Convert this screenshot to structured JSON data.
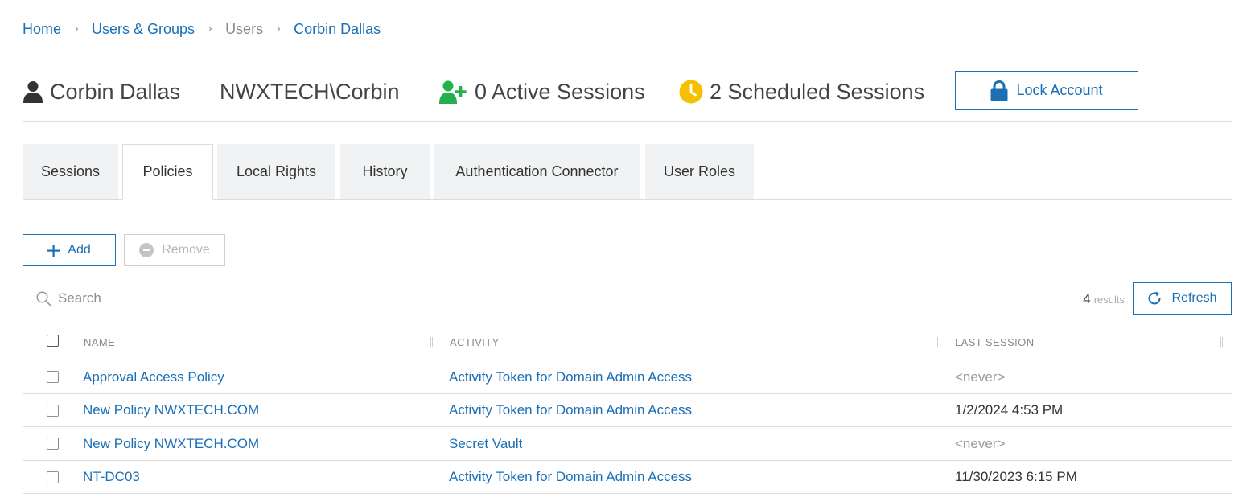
{
  "breadcrumb": {
    "home": "Home",
    "users_groups": "Users & Groups",
    "users": "Users",
    "current": "Corbin Dallas",
    "separator": "›"
  },
  "header": {
    "user_name": "Corbin Dallas",
    "account": "NWXTECH\\Corbin",
    "active_sessions": "0 Active Sessions",
    "scheduled_sessions": "2 Scheduled Sessions",
    "lock_button": "Lock Account",
    "icons": {
      "user": "user-icon",
      "active": "user-plus-icon",
      "scheduled": "clock-icon",
      "lock": "lock-icon"
    },
    "colors": {
      "active": "#22b14c",
      "scheduled": "#f5c000",
      "accent": "#1a6fb5"
    }
  },
  "tabs": [
    {
      "label": "Sessions",
      "active": false
    },
    {
      "label": "Policies",
      "active": true
    },
    {
      "label": "Local Rights",
      "active": false
    },
    {
      "label": "History",
      "active": false
    },
    {
      "label": "Authentication Connector",
      "active": false
    },
    {
      "label": "User Roles",
      "active": false
    }
  ],
  "toolbar": {
    "add_label": "Add",
    "remove_label": "Remove",
    "search_placeholder": "Search",
    "results_count": "4",
    "results_word": "results",
    "refresh_label": "Refresh"
  },
  "table": {
    "columns": [
      "NAME",
      "ACTIVITY",
      "LAST SESSION"
    ],
    "rows": [
      {
        "name": "Approval Access Policy",
        "activity": "Activity Token for Domain Admin Access",
        "last_session": "<never>"
      },
      {
        "name": "New Policy NWXTECH.COM",
        "activity": "Activity Token for Domain Admin Access",
        "last_session": "1/2/2024 4:53 PM"
      },
      {
        "name": "New Policy NWXTECH.COM",
        "activity": "Secret Vault",
        "last_session": "<never>"
      },
      {
        "name": "NT-DC03",
        "activity": "Activity Token for Domain Admin Access",
        "last_session": "11/30/2023 6:15 PM"
      }
    ]
  }
}
